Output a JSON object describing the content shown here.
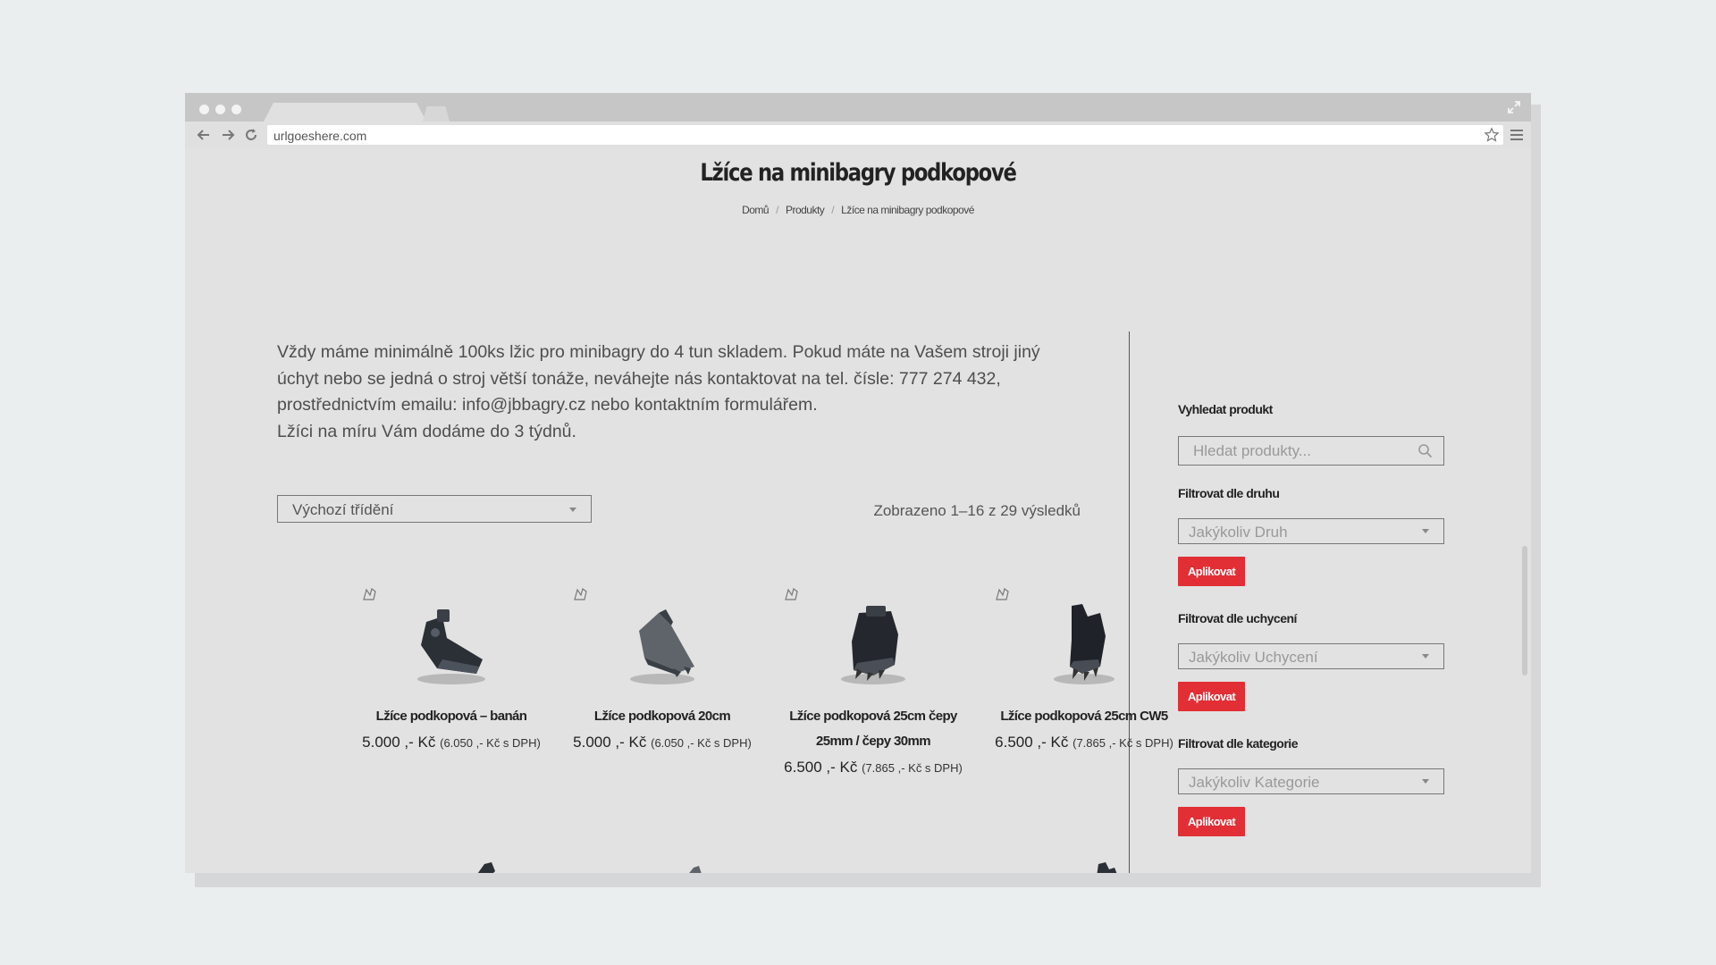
{
  "browser": {
    "url": "urlgoeshere.com"
  },
  "page": {
    "title": "Lžíce na minibagry podkopové",
    "breadcrumb": [
      "Domů",
      "Produkty",
      "Lžíce na minibagry podkopové"
    ],
    "breadcrumb_separator": "/"
  },
  "intro": {
    "paragraph": "Vždy máme minimálně 100ks lžic pro minibagry do 4 tun skladem. Pokud máte na Vašem stroji jiný úchyt nebo se jedná o stroj větší tonáže, neváhejte nás kontaktovat na tel. čísle: 777 274 432, prostřednictvím emailu: info@jbbagry.cz nebo kontaktním formulářem.",
    "line2": "Lžíci na míru Vám dodáme do 3 týdnů."
  },
  "shop": {
    "sort_value": "Výchozí třídění",
    "result_count": "Zobrazeno 1–16 z 29 výsledků"
  },
  "products": [
    {
      "name": "Lžíce podkopová – banán",
      "price": "5.000 ,- Kč",
      "price_vat": "(6.050 ,- Kč s DPH)"
    },
    {
      "name": "Lžíce podkopová 20cm",
      "price": "5.000 ,- Kč",
      "price_vat": "(6.050 ,- Kč s DPH)"
    },
    {
      "name": "Lžíce podkopová 25cm čepy 25mm / čepy 30mm",
      "price": "6.500 ,- Kč",
      "price_vat": "(7.865 ,- Kč s DPH)"
    },
    {
      "name": "Lžíce podkopová 25cm CW5",
      "price": "6.500 ,- Kč",
      "price_vat": "(7.865 ,- Kč s DPH)"
    }
  ],
  "sidebar": {
    "search_heading": "Vyhledat produkt",
    "search_placeholder": "Hledat produkty...",
    "filters": [
      {
        "heading": "Filtrovat dle druhu",
        "value": "Jakýkoliv Druh",
        "button": "Aplikovat"
      },
      {
        "heading": "Filtrovat dle uchycení",
        "value": "Jakýkoliv Uchycení",
        "button": "Aplikovat"
      },
      {
        "heading": "Filtrovat dle kategorie",
        "value": "Jakýkoliv Kategorie",
        "button": "Aplikovat"
      }
    ]
  },
  "colors": {
    "accent": "#e12f35",
    "background": "#e2e2e2",
    "outer_background": "#ebeeef"
  },
  "icons": [
    "expand-icon",
    "back-icon",
    "forward-icon",
    "reload-icon",
    "star-icon",
    "menu-icon",
    "search-icon",
    "chevron-down-icon",
    "product-badge-icon"
  ]
}
